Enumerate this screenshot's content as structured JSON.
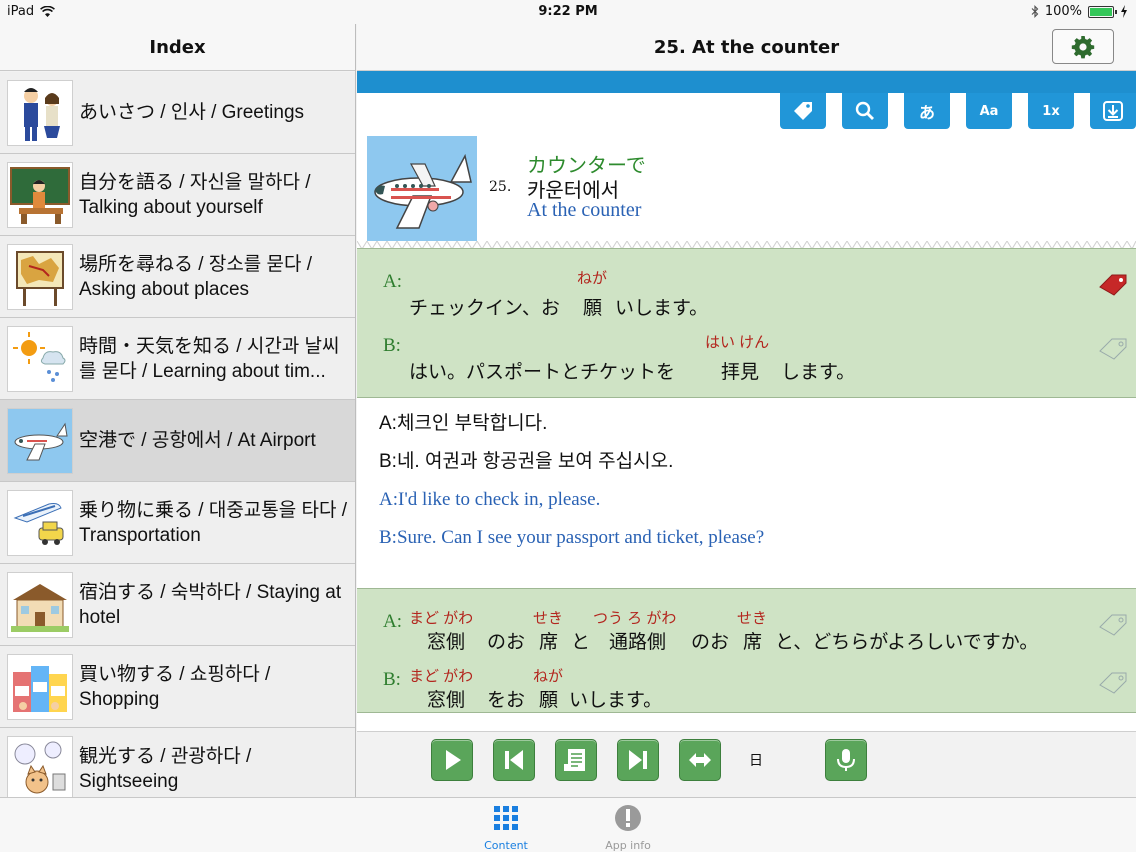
{
  "status": {
    "device": "iPad",
    "time": "9:22 PM",
    "battery": "100%"
  },
  "sidebar": {
    "title": "Index",
    "items": [
      {
        "label": "あいさつ / 인사 / Greetings",
        "icon": "greeting-people-icon"
      },
      {
        "label": "自分を語る / 자신을 말하다 / Talking about yourself",
        "icon": "teacher-icon"
      },
      {
        "label": "場所を尋ねる / 장소를 묻다 / Asking about places",
        "icon": "map-board-icon"
      },
      {
        "label": "時間・天気を知る / 시간과 날씨를 묻다 / Learning about tim...",
        "icon": "weather-icon"
      },
      {
        "label": "空港で / 공항에서 / At Airport",
        "icon": "airplane-icon"
      },
      {
        "label": "乗り物に乗る / 대중교통을 타다 / Transportation",
        "icon": "train-car-icon"
      },
      {
        "label": "宿泊する / 숙박하다 / Staying at hotel",
        "icon": "hotel-icon"
      },
      {
        "label": "買い物する / 쇼핑하다 / Shopping",
        "icon": "shop-icon"
      },
      {
        "label": "観光する / 관광하다 / Sightseeing",
        "icon": "sightseeing-icon"
      }
    ]
  },
  "main": {
    "title": "25. At the counter",
    "toolbar": {
      "hiragana_label": "あ",
      "font_label": "Aa",
      "speed_label": "1x"
    },
    "lesson": {
      "number": "25.",
      "ja": "カウンターで",
      "ko": "카운터에서",
      "en": "At the counter"
    },
    "dialog1": {
      "a_speaker": "A:",
      "a_ruby": "ねが",
      "a_pre": "チェックイン、お",
      "a_kanji": "願",
      "a_post": "いします。",
      "b_speaker": "B:",
      "b_ruby": "はい けん",
      "b_pre": "はい。パスポートとチケットを",
      "b_kanji": "拝見",
      "b_post": "します。"
    },
    "translations": {
      "a_ko": "A:체크인 부탁합니다.",
      "b_ko": "B:네. 여권과 항공권을 보여 주십시오.",
      "a_en": "A:I'd like to check in, please.",
      "b_en": "B:Sure. Can I see your passport and ticket, please?"
    },
    "dialog2": {
      "a_speaker": "A:",
      "a_ruby1": "まど がわ",
      "a_ruby2": "せき",
      "a_ruby3": "つう ろ がわ",
      "a_ruby4": "せき",
      "a_k1": "窓側",
      "a_t1": "のお",
      "a_k2": "席",
      "a_t2": "と",
      "a_k3": "通路側",
      "a_t3": "のお",
      "a_k4": "席",
      "a_t4": "と、どちらがよろしいですか。",
      "b_speaker": "B:",
      "b_ruby1": "まど がわ",
      "b_ruby2": "ねが",
      "b_k1": "窓側",
      "b_t1": "をお",
      "b_k2": "願",
      "b_t2": "いします。"
    },
    "player": {
      "language_label": "日"
    }
  },
  "tabs": [
    {
      "label": "Content",
      "icon": "grid-icon",
      "active": true
    },
    {
      "label": "App info",
      "icon": "info-icon",
      "active": false
    }
  ],
  "colors": {
    "accent": "#1e8fcf",
    "green_button": "#5aa55a",
    "dialog_bg": "#cfe3c5",
    "tag_red": "#c62828"
  }
}
